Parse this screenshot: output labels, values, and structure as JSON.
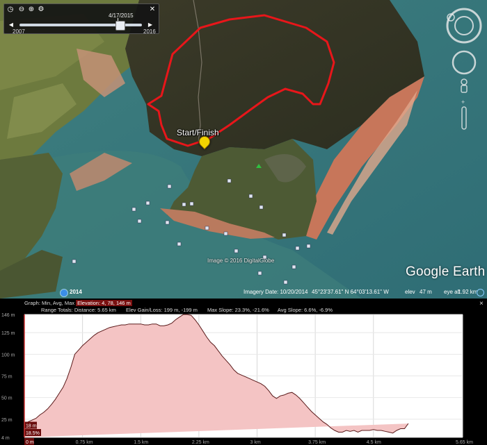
{
  "time_slider": {
    "date": "4/17/2015",
    "start_year": "2007",
    "end_year": "2016",
    "position": 0.85
  },
  "map": {
    "route_label": "Start/Finish",
    "watermark": "Image © 2016 DigitalGlobe",
    "brand": "Google Earth",
    "imagery_year": "2014",
    "icons": [
      "look-joystick-icon",
      "move-joystick-icon",
      "street-view-pegman-icon",
      "zoom-slider-icon"
    ]
  },
  "status_bar": {
    "imagery_date": "Imagery Date: 10/20/2014",
    "coords": "45°23'37.61\" N    64°03'13.61\" W",
    "elev_label": "elev",
    "elev_value": "47 m",
    "eye_alt_label": "eye alt",
    "eye_alt_value": "1.92 km"
  },
  "profile": {
    "graph_label": "Graph:",
    "graph_opts": "Min, Avg, Max",
    "elevation_summary": "Elevation: 4, 78, 146 m",
    "range_label": "Range Totals:",
    "distance": "Distance: 5.65 km",
    "gain_loss": "Elev Gain/Loss: 199 m, -199 m",
    "max_slope": "Max Slope: 23.3%, -21.6%",
    "avg_slope": "Avg Slope: 6.6%, -6.9%",
    "close": "×"
  },
  "chart_data": {
    "type": "area",
    "y_ticks": [
      "146 m",
      "125 m",
      "100 m",
      "75 m",
      "50 m",
      "25 m",
      "4 m"
    ],
    "y_tick_values": [
      146,
      125,
      100,
      75,
      50,
      25,
      4
    ],
    "x_ticks": [
      "0 m",
      "0.75 km",
      "1.5 km",
      "2.25 km",
      "3 km",
      "3.75 km",
      "4.5 km",
      "5.65 km"
    ],
    "x_tick_values": [
      0,
      0.75,
      1.5,
      2.25,
      3,
      3.75,
      4.5,
      5.65
    ],
    "ylim": [
      4,
      146
    ],
    "xlim": [
      0,
      5.65
    ],
    "badges": [
      "18 m",
      "18.5%",
      "0 m"
    ],
    "colors": {
      "fill": "#f4c4c4",
      "line": "#5a1a1a",
      "background": "#ffffff"
    },
    "x": [
      0.0,
      0.05,
      0.1,
      0.15,
      0.2,
      0.25,
      0.3,
      0.35,
      0.4,
      0.45,
      0.5,
      0.55,
      0.6,
      0.65,
      0.7,
      0.75,
      0.8,
      0.85,
      0.9,
      0.95,
      1.0,
      1.05,
      1.1,
      1.15,
      1.2,
      1.25,
      1.3,
      1.35,
      1.4,
      1.45,
      1.5,
      1.55,
      1.6,
      1.65,
      1.7,
      1.75,
      1.8,
      1.85,
      1.9,
      1.95,
      2.0,
      2.05,
      2.1,
      2.15,
      2.2,
      2.25,
      2.3,
      2.35,
      2.4,
      2.45,
      2.5,
      2.55,
      2.6,
      2.65,
      2.7,
      2.75,
      2.8,
      2.85,
      2.9,
      2.95,
      3.0,
      3.05,
      3.1,
      3.15,
      3.2,
      3.25,
      3.3,
      3.35,
      3.4,
      3.45,
      3.5,
      3.55,
      3.6,
      3.65,
      3.7,
      3.75,
      3.8,
      3.85,
      3.9,
      3.95,
      4.0,
      4.05,
      4.1,
      4.15,
      4.2,
      4.25,
      4.3,
      4.35,
      4.4,
      4.45,
      4.5,
      4.55,
      4.6,
      4.65,
      4.7,
      4.75,
      4.8,
      4.85,
      4.9,
      4.95,
      5.0,
      5.05,
      5.1,
      5.15,
      5.2,
      5.25,
      5.3,
      5.35,
      5.4,
      5.45,
      5.5,
      5.55,
      5.6,
      5.65
    ],
    "y": [
      18,
      22,
      24,
      26,
      30,
      33,
      37,
      42,
      48,
      55,
      62,
      72,
      85,
      100,
      105,
      110,
      114,
      118,
      122,
      125,
      127,
      129,
      131,
      132,
      133,
      134,
      134,
      135,
      135,
      135,
      135,
      134,
      134,
      135,
      135,
      133,
      133,
      134,
      136,
      140,
      143,
      146,
      146,
      145,
      140,
      134,
      127,
      120,
      114,
      110,
      104,
      98,
      93,
      88,
      82,
      78,
      76,
      74,
      72,
      70,
      68,
      66,
      63,
      58,
      52,
      49,
      52,
      53,
      55,
      56,
      53,
      49,
      44,
      39,
      34,
      30,
      26,
      22,
      19,
      15,
      12,
      10,
      10,
      12,
      11,
      12,
      10,
      12,
      12,
      12,
      13,
      12,
      12,
      11,
      10,
      9,
      12,
      14,
      14,
      20
    ]
  }
}
